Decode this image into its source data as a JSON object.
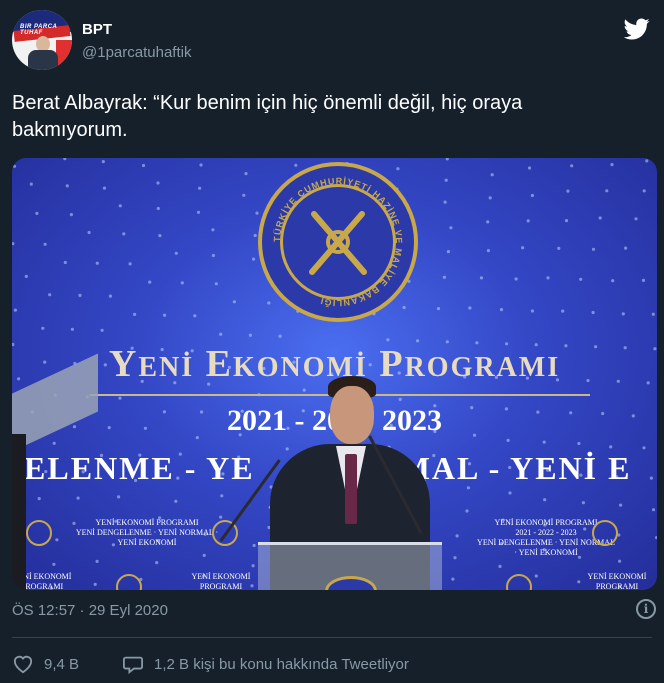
{
  "user": {
    "display_name": "BPT",
    "handle": "@1parcatuhaftik",
    "avatar_text": "BIR PARCA TUHAF"
  },
  "tweet": {
    "text": "Berat Albayrak: “Kur benim için hiç önemli değil, hiç oraya bakmıyorum."
  },
  "media": {
    "seal_text": "TÜRKİYE CUMHURİYETİ HAZİNE VE MALİYE BAKANLIĞI",
    "program_title": {
      "word1_initial": "Y",
      "word1_rest": "ENİ",
      "word2_initial": "E",
      "word2_rest": "KONOMİ",
      "word3_initial": "P",
      "word3_rest": "ROGRAMI"
    },
    "years": "2021 - 20   - 2023",
    "subtitle": "NGELENME - YE            RMAL - YENİ E",
    "panel_title": "YENİ EKONOMİ PROGRAMI",
    "panel_years": "2021 - 2022 - 2023",
    "panel_sub": "YENİ DENGELENME · YENİ NORMAL · YENİ EKONOMİ"
  },
  "timestamp": "ÖS 12:57 · 29 Eyl 2020",
  "actions": {
    "likes": "9,4 B",
    "replies_text": "1,2 B kişi bu konu hakkında Tweetliyor"
  },
  "colors": {
    "background": "#15202b",
    "text_secondary": "#8899a6",
    "divider": "#38444d",
    "twitter_blue": "#ffffff"
  },
  "icons": [
    "twitter-bird-icon",
    "info-icon",
    "heart-icon",
    "comment-icon"
  ]
}
